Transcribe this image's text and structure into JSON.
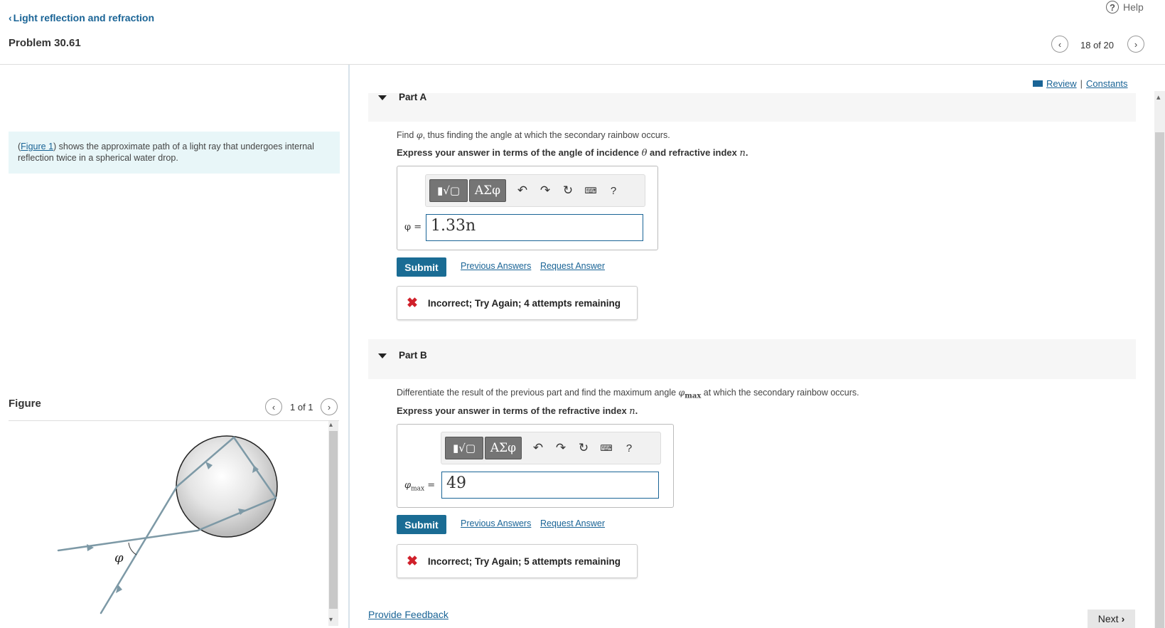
{
  "header": {
    "help_label": "Help",
    "breadcrumb": "Light reflection and refraction",
    "problem_title": "Problem 30.61",
    "nav_count": "18 of 20"
  },
  "intro": {
    "figure_link": "Figure 1",
    "text_after": ") shows the approximate path of a light ray that undergoes internal reflection twice in a spherical water drop."
  },
  "figure": {
    "label": "Figure",
    "count": "1 of 1",
    "phi_label": "φ"
  },
  "review": {
    "review_label": "Review",
    "separator": "|",
    "constants_label": "Constants"
  },
  "part_a": {
    "title": "Part A",
    "instruction_pre": "Find ",
    "instruction_var": "φ",
    "instruction_post": ", thus finding the angle at which the secondary rainbow occurs.",
    "express_pre": "Express your answer in terms of the angle of incidence ",
    "express_var1": "θ",
    "express_mid": " and refractive index ",
    "express_var2": "n",
    "express_end": ".",
    "toolbar_templates": "▮√▢",
    "toolbar_greek": "ΑΣφ",
    "answer_label": "φ =",
    "answer_value": "1.33n",
    "submit": "Submit",
    "previous_answers": "Previous Answers",
    "request_answer": "Request Answer",
    "feedback": "Incorrect; Try Again; 4 attempts remaining"
  },
  "part_b": {
    "title": "Part B",
    "instruction_pre": "Differentiate the result of the previous part and find the maximum angle ",
    "instruction_var": "φ",
    "instruction_sub": "max",
    "instruction_post": " at which the secondary rainbow occurs.",
    "express_pre": "Express your answer in terms of the refractive index ",
    "express_var": "n",
    "express_end": ".",
    "toolbar_templates": "▮√▢",
    "toolbar_greek": "ΑΣφ",
    "answer_label_var": "φ",
    "answer_label_sub": "max",
    "answer_label_eq": " =",
    "answer_value": "49",
    "submit": "Submit",
    "previous_answers": "Previous Answers",
    "request_answer": "Request Answer",
    "feedback": "Incorrect; Try Again; 5 attempts remaining"
  },
  "footer": {
    "provide_feedback": "Provide Feedback",
    "next": "Next"
  },
  "toolbar_icons": [
    "undo-icon",
    "redo-icon",
    "reset-icon",
    "keyboard-icon",
    "help-icon"
  ],
  "colors": {
    "link": "#1a6496",
    "submit_bg": "#1a6c94",
    "intro_bg": "#e8f6f8",
    "error_red": "#d0202a"
  }
}
